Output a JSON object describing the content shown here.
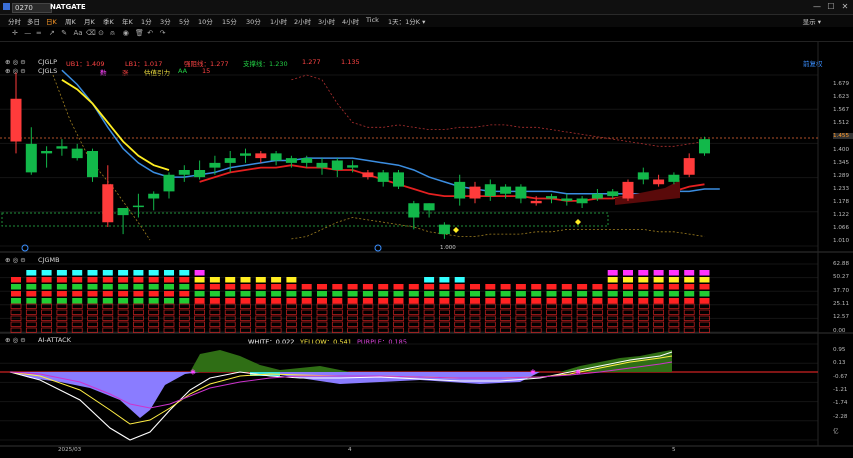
{
  "titlebar": {
    "code": "0270",
    "name": "NATGATE",
    "window_buttons": [
      "—",
      "☐",
      "✕"
    ]
  },
  "periods": [
    {
      "label": "分时",
      "active": false
    },
    {
      "label": "多日",
      "active": false
    },
    {
      "label": "日K",
      "active": true
    },
    {
      "label": "周K",
      "active": false
    },
    {
      "label": "月K",
      "active": false
    },
    {
      "label": "季K",
      "active": false
    },
    {
      "label": "年K",
      "active": false
    },
    {
      "label": "1分",
      "active": false
    },
    {
      "label": "3分",
      "active": false
    },
    {
      "label": "5分",
      "active": false
    },
    {
      "label": "10分",
      "active": false
    },
    {
      "label": "15分",
      "active": false
    },
    {
      "label": "30分",
      "active": false
    },
    {
      "label": "1小时",
      "active": false
    },
    {
      "label": "2小时",
      "active": false
    },
    {
      "label": "3小时",
      "active": false
    },
    {
      "label": "4小时",
      "active": false
    },
    {
      "label": "Tick",
      "active": false
    },
    {
      "label": "1天：1分K ▾",
      "active": false
    }
  ],
  "display_button": "显示 ▾",
  "toolbar": {
    "icons": [
      "crosshair-icon",
      "line-icon",
      "hline-icon",
      "arrow-icon",
      "pen-icon",
      "text-icon",
      "eraser-icon",
      "magnet-icon",
      "lock-icon",
      "eye-icon",
      "delete-icon",
      "undo-icon",
      "redo-icon"
    ],
    "glyphs": [
      "✛",
      "—",
      "═",
      "↗",
      "✎",
      "Aa",
      "⌫",
      "⊙",
      "⍝",
      "◉",
      "🗑",
      "↶",
      "↷"
    ]
  },
  "main_panel": {
    "title1": "CJGLP",
    "title2": "CJGLS",
    "legend1": [
      {
        "label": "UB1：1.409",
        "color": "#ff4444"
      },
      {
        "label": "LB1：1.017",
        "color": "#ff4444"
      },
      {
        "label": "强阻线：1.277",
        "color": "#ff4444"
      },
      {
        "label": "支撑线：1.230",
        "color": "#22cc44"
      },
      {
        "label": "1.277",
        "color": "#ff4444"
      },
      {
        "label": "1.135",
        "color": "#ff4444"
      }
    ],
    "legend2": [
      {
        "label": "勤",
        "color": "#ff44ff"
      },
      {
        "label": "涨",
        "color": "#ff4444"
      },
      {
        "label": "估值引力",
        "color": "#ffee44"
      },
      {
        "label": "AA",
        "color": "#22cc44"
      },
      {
        "label": "15",
        "color": "#ff4444"
      }
    ],
    "right_link": "前复权",
    "price_labels": [
      "1.679",
      "1.623",
      "1.567",
      "1.512",
      "1.455",
      "1.400",
      "1.345",
      "1.289",
      "1.233",
      "1.178",
      "1.122",
      "1.066",
      "1.010"
    ],
    "current_price": "1.455",
    "low_label": "1.000"
  },
  "cjgmb": {
    "title": "CJGMB",
    "axis": [
      "62.88",
      "50.27",
      "37.70",
      "25.11",
      "12.57",
      "0.00"
    ]
  },
  "attack": {
    "title": "AI-ATTACK",
    "white_label": "WHITE：0.022",
    "yellow_label": "YELLOW：0.541",
    "purple_label": "PURPLE：0.185",
    "axis": [
      "0.95",
      "0.13",
      "-0.67",
      "-1.21",
      "-1.74",
      "-2.28",
      "亿"
    ]
  },
  "xaxis": [
    "2025/03",
    "4",
    "5"
  ],
  "colors": {
    "up": "#ff3b3b",
    "down": "#12b84a",
    "accent": "#ff9a28"
  },
  "chart_data": {
    "type": "candlestick",
    "note": "daily candles (open, close, high, low) read from the price axis",
    "candles": [
      [
        1.62,
        1.44,
        1.73,
        1.39
      ],
      [
        1.31,
        1.43,
        1.5,
        1.3
      ],
      [
        1.39,
        1.4,
        1.42,
        1.33
      ],
      [
        1.41,
        1.42,
        1.45,
        1.38
      ],
      [
        1.37,
        1.41,
        1.43,
        1.36
      ],
      [
        1.29,
        1.4,
        1.41,
        1.27
      ],
      [
        1.26,
        1.1,
        1.34,
        1.08
      ],
      [
        1.13,
        1.16,
        1.16,
        1.05
      ],
      [
        1.17,
        1.17,
        1.22,
        1.12
      ],
      [
        1.2,
        1.22,
        1.23,
        1.15
      ],
      [
        1.23,
        1.3,
        1.31,
        1.2
      ],
      [
        1.3,
        1.32,
        1.34,
        1.27
      ],
      [
        1.29,
        1.32,
        1.36,
        1.28
      ],
      [
        1.33,
        1.35,
        1.38,
        1.3
      ],
      [
        1.35,
        1.37,
        1.4,
        1.31
      ],
      [
        1.38,
        1.39,
        1.41,
        1.35
      ],
      [
        1.39,
        1.37,
        1.4,
        1.35
      ],
      [
        1.36,
        1.39,
        1.4,
        1.34
      ],
      [
        1.35,
        1.37,
        1.38,
        1.33
      ],
      [
        1.35,
        1.37,
        1.38,
        1.33
      ],
      [
        1.33,
        1.35,
        1.37,
        1.3
      ],
      [
        1.32,
        1.36,
        1.37,
        1.29
      ],
      [
        1.33,
        1.34,
        1.36,
        1.31
      ],
      [
        1.31,
        1.29,
        1.32,
        1.28
      ],
      [
        1.27,
        1.31,
        1.32,
        1.25
      ],
      [
        1.25,
        1.31,
        1.32,
        1.24
      ],
      [
        1.12,
        1.18,
        1.19,
        1.07
      ],
      [
        1.15,
        1.18,
        1.18,
        1.12
      ],
      [
        1.05,
        1.09,
        1.1,
        1.03
      ],
      [
        1.2,
        1.27,
        1.3,
        1.17
      ],
      [
        1.25,
        1.2,
        1.27,
        1.18
      ],
      [
        1.21,
        1.26,
        1.28,
        1.19
      ],
      [
        1.22,
        1.25,
        1.26,
        1.2
      ],
      [
        1.2,
        1.25,
        1.26,
        1.18
      ],
      [
        1.19,
        1.18,
        1.21,
        1.17
      ],
      [
        1.2,
        1.21,
        1.22,
        1.18
      ],
      [
        1.19,
        1.2,
        1.22,
        1.17
      ],
      [
        1.18,
        1.2,
        1.21,
        1.16
      ],
      [
        1.2,
        1.22,
        1.24,
        1.19
      ],
      [
        1.21,
        1.23,
        1.24,
        1.2
      ],
      [
        1.27,
        1.2,
        1.28,
        1.19
      ],
      [
        1.28,
        1.31,
        1.33,
        1.26
      ],
      [
        1.28,
        1.26,
        1.3,
        1.25
      ],
      [
        1.27,
        1.3,
        1.31,
        1.26
      ],
      [
        1.37,
        1.3,
        1.39,
        1.29
      ],
      [
        1.39,
        1.45,
        1.46,
        1.38
      ]
    ]
  }
}
